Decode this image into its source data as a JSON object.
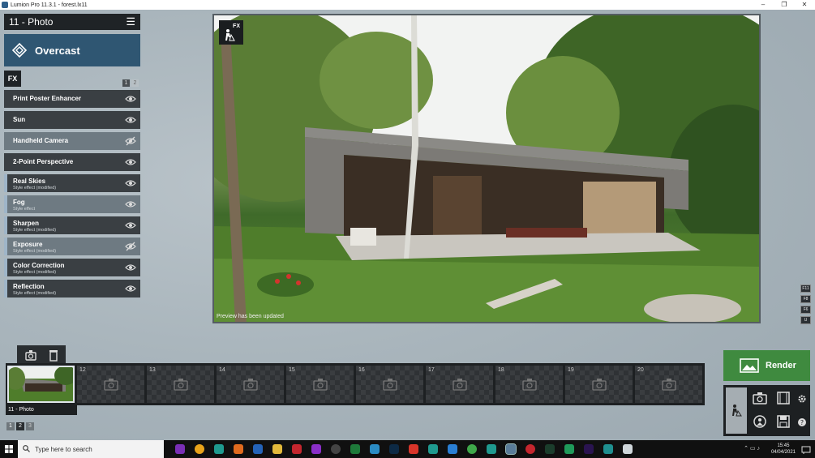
{
  "window": {
    "title": "Lumion Pro 11.3.1 - forest.lx11",
    "minimize": "–",
    "maximize": "❐",
    "close": "✕"
  },
  "left_panel": {
    "mode_title": "11 - Photo",
    "menu_glyph": "☰",
    "style_name": "Overcast",
    "fx_label": "FX",
    "pages": [
      "1",
      "2"
    ],
    "effects": [
      {
        "name": "Print Poster Enhancer",
        "sub": "",
        "visible": true
      },
      {
        "name": "Sun",
        "sub": "",
        "visible": true
      },
      {
        "name": "Handheld Camera",
        "sub": "",
        "visible": false
      },
      {
        "name": "2-Point Perspective",
        "sub": "",
        "visible": true
      },
      {
        "name": "Real Skies",
        "sub": "Style effect (modified)",
        "visible": true
      },
      {
        "name": "Fog",
        "sub": "Style effect",
        "visible": true
      },
      {
        "name": "Sharpen",
        "sub": "Style effect (modified)",
        "visible": true
      },
      {
        "name": "Exposure",
        "sub": "Style effect (modified)",
        "visible": false
      },
      {
        "name": "Color Correction",
        "sub": "Style effect (modified)",
        "visible": true
      },
      {
        "name": "Reflection",
        "sub": "Style effect (modified)",
        "visible": true
      }
    ]
  },
  "viewport": {
    "fx_badge": "FX",
    "status": "Preview has been updated"
  },
  "side_keys": [
    "F11",
    "F8",
    "F6",
    "U"
  ],
  "filmstrip": {
    "active_label": "11 - Photo",
    "slots": [
      "12",
      "13",
      "14",
      "15",
      "16",
      "17",
      "18",
      "19",
      "20"
    ],
    "pages": [
      "1",
      "2",
      "3"
    ]
  },
  "render": {
    "label": "Render"
  },
  "taskbar": {
    "search_placeholder": "Type here to search",
    "time": "15:45",
    "date": "04/04/2021"
  },
  "colors": {
    "accent_style": "#2f5672",
    "render_green": "#3f8a3f"
  }
}
